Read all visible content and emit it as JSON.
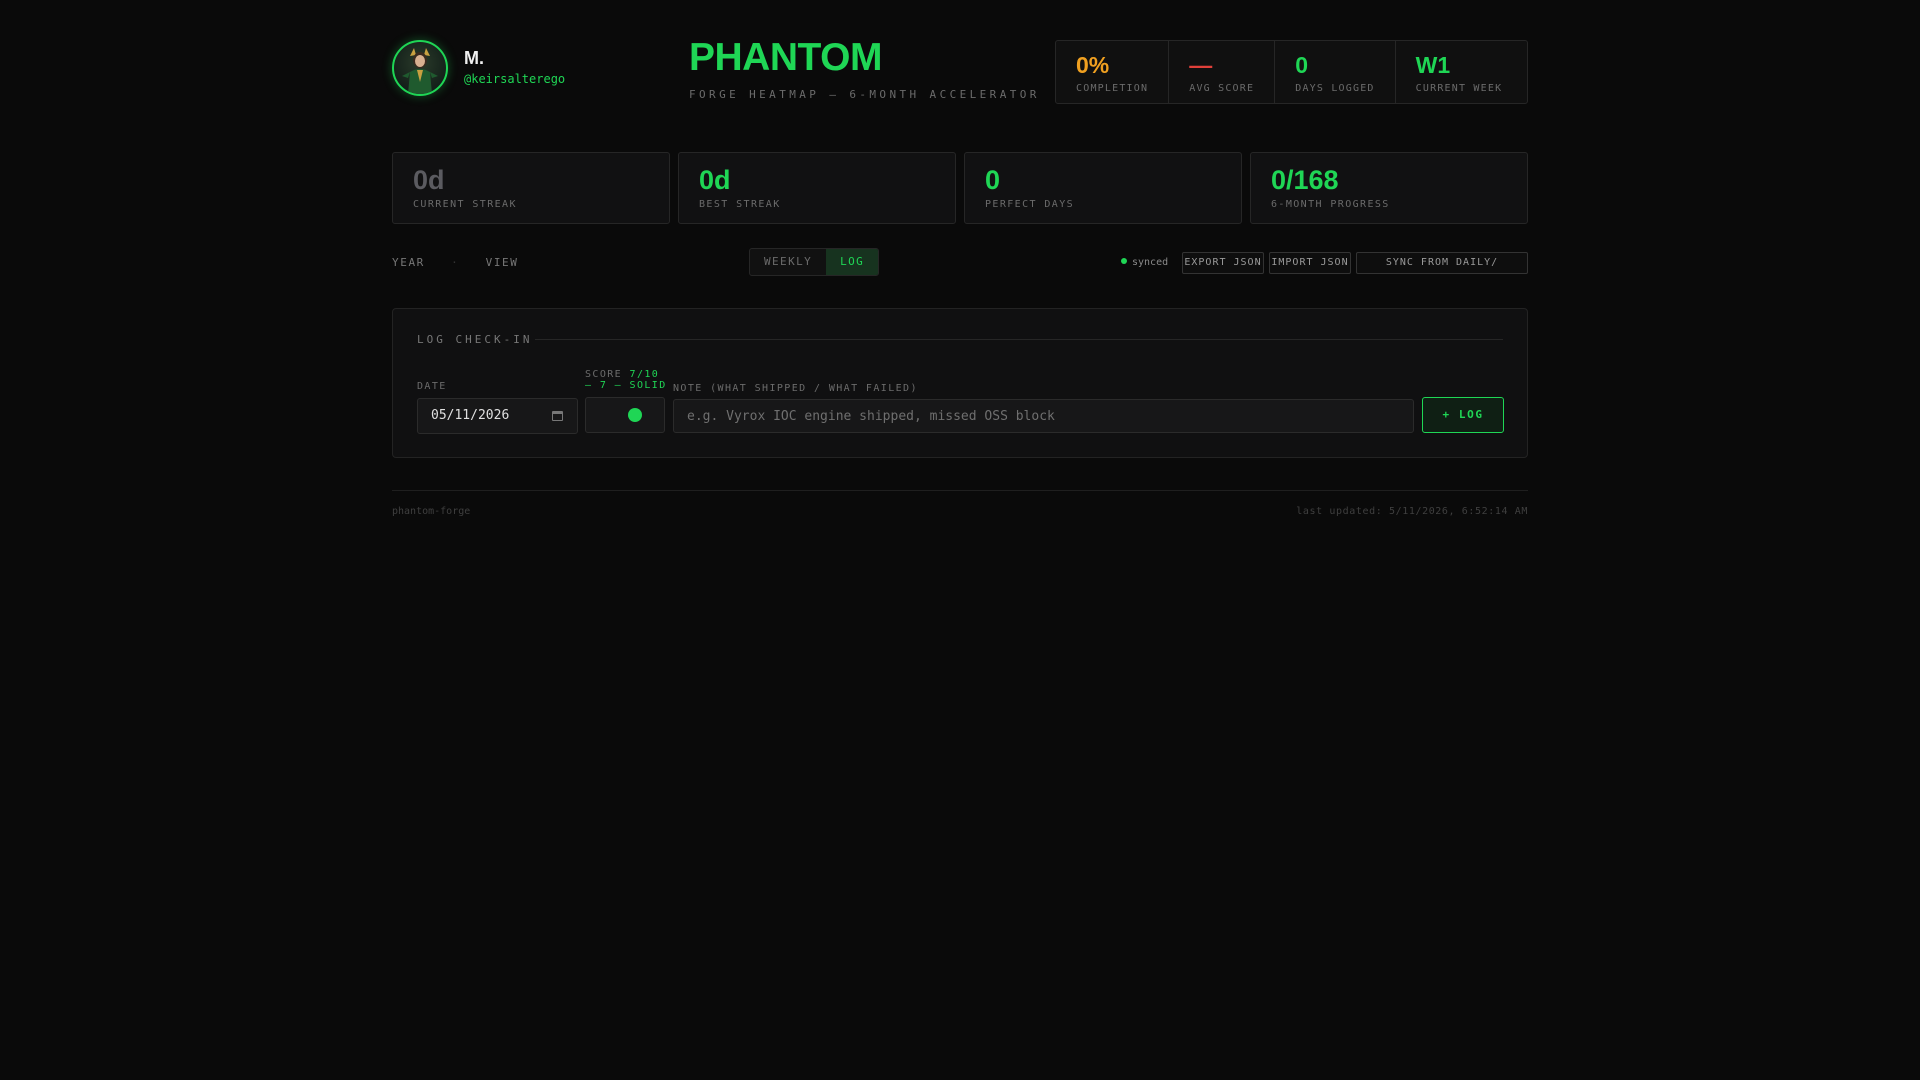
{
  "profile": {
    "name": "M.",
    "handle": "@keirsalterego"
  },
  "brand": {
    "title": "PHANTOM",
    "subtitle": "FORGE HEATMAP — 6-MONTH ACCELERATOR"
  },
  "kpis": [
    {
      "value": "0%",
      "label": "COMPLETION",
      "color": "#f0a020"
    },
    {
      "value": "—",
      "label": "AVG SCORE",
      "color": "#e0403a"
    },
    {
      "value": "0",
      "label": "DAYS LOGGED",
      "color": "#1fd655"
    },
    {
      "value": "W1",
      "label": "CURRENT WEEK",
      "color": "#1fd655"
    }
  ],
  "stats": [
    {
      "value": "0d",
      "label": "CURRENT STREAK",
      "color": "#5b5b60"
    },
    {
      "value": "0d",
      "label": "BEST STREAK",
      "color": "#1fd655"
    },
    {
      "value": "0",
      "label": "PERFECT DAYS",
      "color": "#1fd655"
    },
    {
      "value": "0/168",
      "label": "6-MONTH PROGRESS",
      "color": "#1fd655"
    }
  ],
  "toolbar": {
    "nav": [
      "YEAR",
      "·",
      "VIEW"
    ],
    "tabs": [
      {
        "label": "WEEKLY",
        "active": false
      },
      {
        "label": "LOG",
        "active": true
      }
    ],
    "sync_status": "synced",
    "export_label": "EXPORT JSON",
    "import_label": "IMPORT JSON",
    "sync_label": "SYNC FROM DAILY/"
  },
  "log_panel": {
    "title": "LOG CHECK-IN",
    "date_label": "DATE",
    "date_value": "05/11/2026",
    "score_label": "SCORE",
    "score_value": "7/10",
    "score_desc": "— 7 — SOLID",
    "score": 0.7,
    "note_label": "NOTE (WHAT SHIPPED / WHAT FAILED)",
    "note_placeholder": "e.g. Vyrox IOC engine shipped, missed OSS block",
    "submit_label": "+ LOG"
  },
  "footer": {
    "left": "phantom-forge",
    "right": "last updated: 5/11/2026, 6:52:14 AM"
  },
  "colors": {
    "accent": "#1fd655",
    "warning": "#f0a020",
    "danger": "#e0403a",
    "background": "#0a0a0a"
  }
}
